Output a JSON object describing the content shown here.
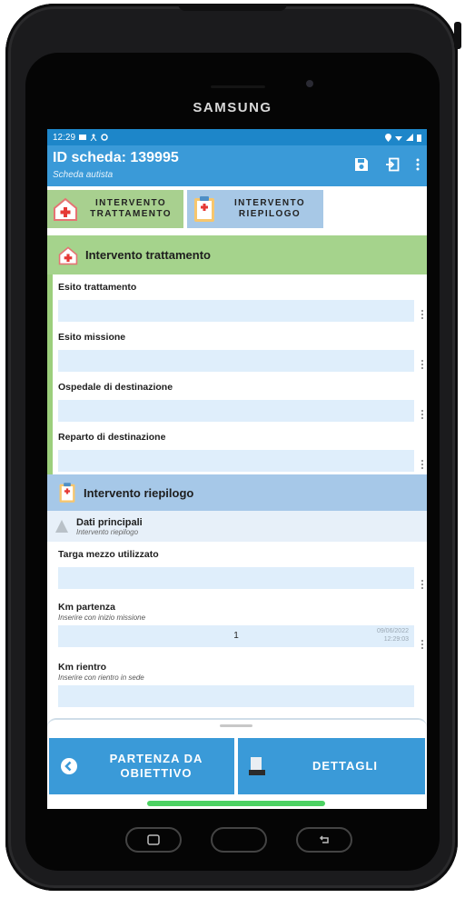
{
  "device": {
    "brand": "SAMSUNG"
  },
  "statusbar": {
    "time": "12:29"
  },
  "appbar": {
    "title": "ID scheda: 139995",
    "subtitle": "Scheda autista"
  },
  "tabs": [
    {
      "label1": "INTERVENTO",
      "label2": "TRATTAMENTO"
    },
    {
      "label1": "INTERVENTO",
      "label2": "RIEPILOGO"
    }
  ],
  "section1": {
    "title": "Intervento trattamento",
    "fields": [
      {
        "label": "Esito trattamento",
        "value": ""
      },
      {
        "label": "Esito missione",
        "value": ""
      },
      {
        "label": "Ospedale di destinazione",
        "value": ""
      },
      {
        "label": "Reparto di destinazione",
        "value": ""
      }
    ]
  },
  "section2": {
    "title": "Intervento riepilogo",
    "sub_title": "Dati principali",
    "sub_subtitle": "Intervento riepilogo",
    "fields": [
      {
        "label": "Targa mezzo utilizzato",
        "hint": "",
        "value": ""
      },
      {
        "label": "Km partenza",
        "hint": "Inserire con inizio missione",
        "value": "1",
        "stamp_date": "09/06/2022",
        "stamp_time": "12:29:03"
      },
      {
        "label": "Km rientro",
        "hint": "Inserire con rientro in sede",
        "value": ""
      }
    ]
  },
  "bottom": {
    "btn1_line1": "PARTENZA DA",
    "btn1_line2": "OBIETTIVO",
    "btn2": "DETTAGLI"
  },
  "colors": {
    "primary": "#3a9ad8",
    "status": "#1d86c9",
    "green": "#a5d38c",
    "blue": "#a6c8e8",
    "field": "#dfeefb"
  },
  "icons": [
    "save-icon",
    "exit-icon",
    "more-vert-icon",
    "first-aid-icon",
    "clipboard-icon",
    "warning-icon",
    "back-circle-icon",
    "document-icon",
    "recents-icon",
    "home-icon",
    "back-icon"
  ]
}
